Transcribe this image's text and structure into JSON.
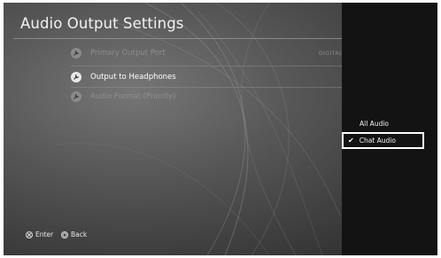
{
  "title": "Audio Output Settings",
  "settings": [
    {
      "label": "Primary Output Port",
      "value": "DIGITAL",
      "state": "dim"
    },
    {
      "label": "Output to Headphones",
      "state": "active"
    },
    {
      "label": "Audio Format (Priority)",
      "state": "dim"
    }
  ],
  "footer": {
    "enter_label": "Enter",
    "back_label": "Back"
  },
  "menu": {
    "options": [
      "All Audio",
      "Chat Audio"
    ],
    "selected": "Chat Audio",
    "check_glyph": "✔"
  }
}
